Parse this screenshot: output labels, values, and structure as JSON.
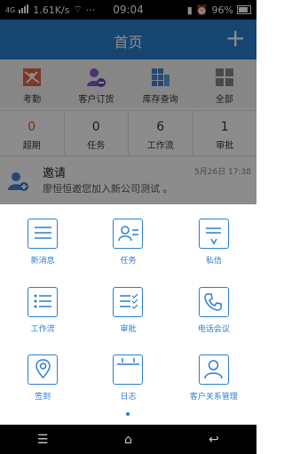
{
  "status": {
    "network_label": "4G",
    "speed": "1.61K/s",
    "time": "09:04",
    "battery": "96%"
  },
  "header": {
    "title": "首页",
    "add_glyph": "+"
  },
  "quick_menu": [
    {
      "label": "考勤",
      "icon": "attendance-map-icon"
    },
    {
      "label": "客户订货",
      "icon": "customer-order-icon"
    },
    {
      "label": "库存查询",
      "icon": "inventory-icon"
    },
    {
      "label": "全部",
      "icon": "all-apps-icon"
    }
  ],
  "counts": [
    {
      "value": "0",
      "label": "超期"
    },
    {
      "value": "0",
      "label": "任务"
    },
    {
      "value": "6",
      "label": "工作流"
    },
    {
      "value": "1",
      "label": "审批"
    }
  ],
  "invite": {
    "title": "邀请",
    "time": "5月26日 17:38",
    "message": "廖恒恒邀您加入新公司测试 。"
  },
  "grid_menu": [
    {
      "label": "新消息",
      "icon": "message-icon"
    },
    {
      "label": "任务",
      "icon": "task-icon"
    },
    {
      "label": "私信",
      "icon": "private-message-icon"
    },
    {
      "label": "工作流",
      "icon": "workflow-icon"
    },
    {
      "label": "审批",
      "icon": "approval-icon"
    },
    {
      "label": "电话会议",
      "icon": "phone-icon"
    },
    {
      "label": "签到",
      "icon": "checkin-location-icon"
    },
    {
      "label": "日志",
      "icon": "calendar-log-icon"
    },
    {
      "label": "客户关系管理",
      "icon": "crm-person-icon"
    }
  ],
  "colors": {
    "brand": "#2a7ed0",
    "alert": "#e05a2b"
  }
}
